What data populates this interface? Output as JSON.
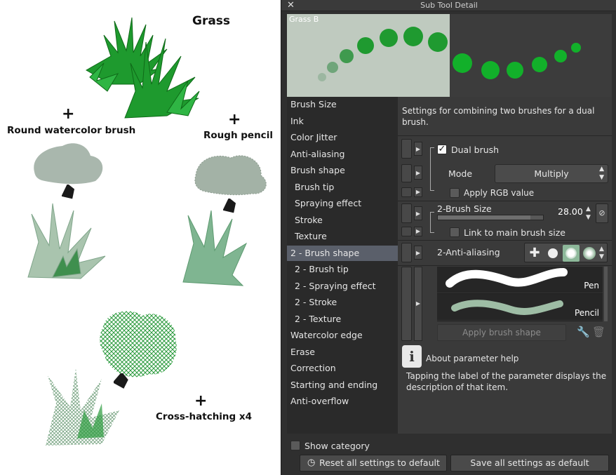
{
  "illustration": {
    "grass_label": "Grass",
    "plus1": "+",
    "round_watercolor_label": "Round watercolor brush",
    "plus2": "+",
    "rough_pencil_label": "Rough pencil",
    "plus3": "+",
    "cross_hatching_label": "Cross-hatching x4",
    "colors": {
      "grass_dark": "#0f7a1c",
      "grass_light": "#2fb544",
      "wash": "#a9b7ad",
      "hatch": "#2a9a3c"
    }
  },
  "panel": {
    "title": "Sub Tool Detail",
    "close_icon": "close-icon",
    "preview_name": "Grass B",
    "categories": [
      {
        "label": "Brush Size"
      },
      {
        "label": "Ink"
      },
      {
        "label": "Color Jitter"
      },
      {
        "label": "Anti-aliasing"
      },
      {
        "label": "Brush shape"
      },
      {
        "label": "Brush tip"
      },
      {
        "label": "Spraying effect"
      },
      {
        "label": "Stroke"
      },
      {
        "label": "Texture"
      },
      {
        "label": "2 - Brush shape"
      },
      {
        "label": "2 - Brush tip"
      },
      {
        "label": "2 - Spraying effect"
      },
      {
        "label": "2 - Stroke"
      },
      {
        "label": "2 - Texture"
      },
      {
        "label": "Watercolor edge"
      },
      {
        "label": "Erase"
      },
      {
        "label": "Correction"
      },
      {
        "label": "Starting and ending"
      },
      {
        "label": "Anti-overflow"
      }
    ],
    "selected_category": "2 - Brush shape",
    "description": "Settings for combining two brushes for a dual brush.",
    "dual_brush_label": "Dual brush",
    "dual_brush_checked": true,
    "mode_label": "Mode",
    "mode_value": "Multiply",
    "apply_rgb_label": "Apply RGB value",
    "brush_size_label": "2-Brush Size",
    "brush_size_value": "28.00",
    "link_main_label": "Link to main brush size",
    "anti_aliasing_label": "2-Anti-aliasing",
    "anti_aliasing_level": "Medium",
    "shapes": [
      {
        "name": "Pen"
      },
      {
        "name": "Pencil"
      }
    ],
    "apply_brush_shape_label": "Apply brush shape",
    "help_title": "About parameter help",
    "help_text": "Tapping the label of the parameter displays the description of that item.",
    "show_category_label": "Show category",
    "reset_label": "Reset all settings to default",
    "save_label": "Save all settings as default",
    "colors": {
      "panel": "#2f2f2f",
      "selected": "#5a5f6a",
      "preview_light": "#bfcabf"
    }
  }
}
